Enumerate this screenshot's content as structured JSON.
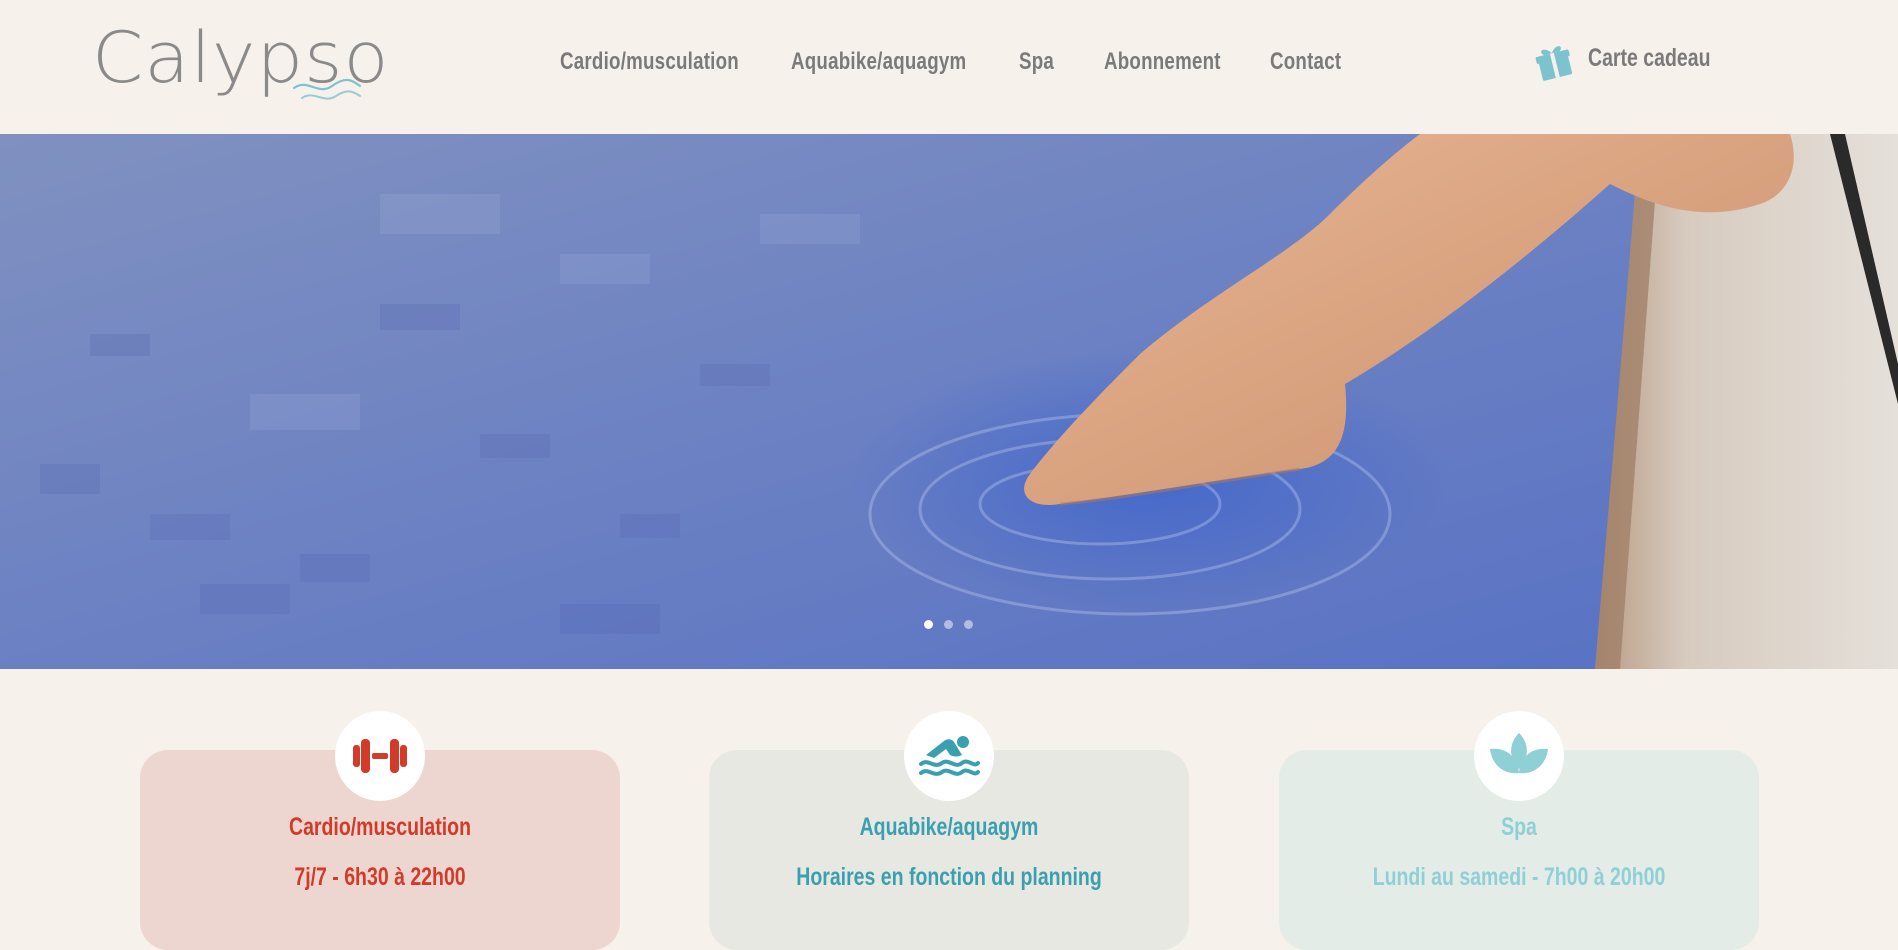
{
  "brand": {
    "name": "Calypso",
    "text_color": "#8a8a8a",
    "wave_color": "#7cc3cf"
  },
  "nav": {
    "items": [
      {
        "label": "Cardio/musculation"
      },
      {
        "label": "Aquabike/aquagym"
      },
      {
        "label": "Spa"
      },
      {
        "label": "Abonnement"
      },
      {
        "label": "Contact"
      }
    ]
  },
  "gift": {
    "label": "Carte cadeau",
    "icon": "gift-icon",
    "icon_color": "#7cc3cf"
  },
  "hero": {
    "image_description_icon": "pool-photo",
    "slides_total": 3,
    "active_slide": 1
  },
  "cards": [
    {
      "title": "Cardio/musculation",
      "subtitle": "7j/7 - 6h30 à 22h00",
      "icon": "dumbbell-icon",
      "text_color": "#d23a2a",
      "bg_color": "#edd6cf"
    },
    {
      "title": "Aquabike/aquagym",
      "subtitle": "Horaires en fonction du planning",
      "icon": "swimmer-icon",
      "text_color": "#3a9fae",
      "bg_color": "#e8e8e3"
    },
    {
      "title": "Spa",
      "subtitle": "Lundi au samedi - 7h00 à 20h00",
      "icon": "lotus-icon",
      "text_color": "#8fcfd6",
      "bg_color": "#e3ece7"
    }
  ],
  "colors": {
    "background": "#f7f1eb",
    "nav_text": "#7a7a7a"
  }
}
